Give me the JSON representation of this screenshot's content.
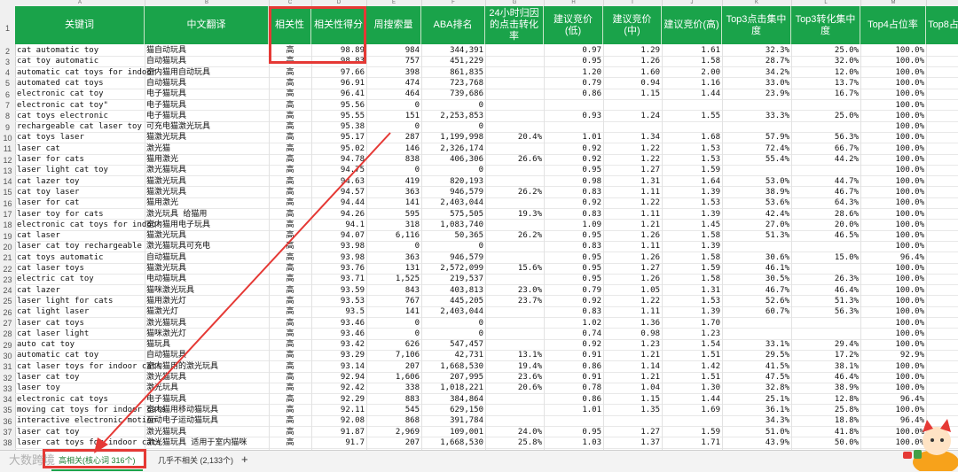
{
  "columns": [
    "A",
    "B",
    "C",
    "D",
    "E",
    "F",
    "G",
    "H",
    "I",
    "J",
    "K",
    "L",
    "M"
  ],
  "headers": [
    "关键词",
    "中文翻译",
    "相关性",
    "相关性得分",
    "周搜索量",
    "ABA排名",
    "24小时归因的点击转化率",
    "建议竞价(低)",
    "建议竞价(中)",
    "建议竞价(高)",
    "Top3点击集中度",
    "Top3转化集中度",
    "Top4占位率",
    "Top8占"
  ],
  "rows": [
    [
      "cat automatic toy",
      "猫自动玩具",
      "高",
      "98.89",
      "984",
      "344,391",
      "",
      "0.97",
      "1.29",
      "1.61",
      "32.3%",
      "25.0%",
      "100.0%"
    ],
    [
      "cat toy automatic",
      "自动猫玩具",
      "高",
      "98.83",
      "757",
      "451,229",
      "",
      "0.95",
      "1.26",
      "1.58",
      "28.7%",
      "32.0%",
      "100.0%"
    ],
    [
      "automatic cat toys for indoor",
      "室内猫用自动玩具",
      "高",
      "97.66",
      "398",
      "861,835",
      "",
      "1.20",
      "1.60",
      "2.00",
      "34.2%",
      "12.0%",
      "100.0%"
    ],
    [
      "automated cat toys",
      "自动猫玩具",
      "高",
      "96.91",
      "474",
      "723,768",
      "",
      "0.79",
      "0.94",
      "1.16",
      "33.0%",
      "13.7%",
      "100.0%"
    ],
    [
      "electronic cat toy",
      "电子猫玩具",
      "高",
      "96.41",
      "464",
      "739,686",
      "",
      "0.86",
      "1.15",
      "1.44",
      "23.9%",
      "16.7%",
      "100.0%"
    ],
    [
      "electronic cat toy\"",
      "电子猫玩具",
      "高",
      "95.56",
      "0",
      "0",
      "",
      "",
      "",
      "",
      "",
      "",
      "100.0%"
    ],
    [
      "cat toys electronic",
      "电子猫玩具",
      "高",
      "95.55",
      "151",
      "2,253,853",
      "",
      "0.93",
      "1.24",
      "1.55",
      "33.3%",
      "25.0%",
      "100.0%"
    ],
    [
      "rechargeable cat laser toy",
      "可充电猫激光玩具",
      "高",
      "95.38",
      "0",
      "0",
      "",
      "",
      "",
      "",
      "",
      "",
      "100.0%"
    ],
    [
      "cat toys laser",
      "猫激光玩具",
      "高",
      "95.17",
      "287",
      "1,199,998",
      "20.4%",
      "1.01",
      "1.34",
      "1.68",
      "57.9%",
      "56.3%",
      "100.0%"
    ],
    [
      "laser cat",
      "激光猫",
      "高",
      "95.02",
      "146",
      "2,326,174",
      "",
      "0.92",
      "1.22",
      "1.53",
      "72.4%",
      "66.7%",
      "100.0%"
    ],
    [
      "laser for cats",
      "猫用激光",
      "高",
      "94.78",
      "838",
      "406,306",
      "26.6%",
      "0.92",
      "1.22",
      "1.53",
      "55.4%",
      "44.2%",
      "100.0%"
    ],
    [
      "laser light cat toy",
      "激光猫玩具",
      "高",
      "94.75",
      "0",
      "0",
      "",
      "0.95",
      "1.27",
      "1.59",
      "",
      "",
      "100.0%"
    ],
    [
      "cat lazer toy",
      "猫激光玩具",
      "高",
      "94.63",
      "419",
      "820,193",
      "",
      "0.98",
      "1.31",
      "1.64",
      "53.0%",
      "44.7%",
      "100.0%"
    ],
    [
      "cat toy laser",
      "猫激光玩具",
      "高",
      "94.57",
      "363",
      "946,579",
      "26.2%",
      "0.83",
      "1.11",
      "1.39",
      "38.9%",
      "46.7%",
      "100.0%"
    ],
    [
      "laser for cat",
      "猫用激光",
      "高",
      "94.44",
      "141",
      "2,403,044",
      "",
      "0.92",
      "1.22",
      "1.53",
      "53.6%",
      "64.3%",
      "100.0%"
    ],
    [
      "laser toy for cats",
      "激光玩具 给猫用",
      "高",
      "94.26",
      "595",
      "575,505",
      "19.3%",
      "0.83",
      "1.11",
      "1.39",
      "42.4%",
      "28.6%",
      "100.0%"
    ],
    [
      "electronic cat toys for indoor",
      "室内猫用电子玩具",
      "高",
      "94.1",
      "318",
      "1,083,740",
      "",
      "1.09",
      "1.21",
      "1.45",
      "27.0%",
      "20.0%",
      "100.0%"
    ],
    [
      "cat laser",
      "猫激光玩具",
      "高",
      "94.07",
      "6,116",
      "50,365",
      "26.2%",
      "0.95",
      "1.26",
      "1.58",
      "51.3%",
      "46.5%",
      "100.0%"
    ],
    [
      "laser cat toy rechargeable",
      "激光猫玩具可充电",
      "高",
      "93.98",
      "0",
      "0",
      "",
      "0.83",
      "1.11",
      "1.39",
      "",
      "",
      "100.0%"
    ],
    [
      "cat toys automatic",
      "自动猫玩具",
      "高",
      "93.98",
      "363",
      "946,579",
      "",
      "0.95",
      "1.26",
      "1.58",
      "30.6%",
      "15.0%",
      "96.4%"
    ],
    [
      "cat laser toys",
      "猫激光玩具",
      "高",
      "93.76",
      "131",
      "2,572,099",
      "15.6%",
      "0.95",
      "1.27",
      "1.59",
      "46.1%",
      "",
      "100.0%"
    ],
    [
      "electric cat toy",
      "电动猫玩具",
      "高",
      "93.71",
      "1,525",
      "219,537",
      "",
      "0.95",
      "1.26",
      "1.58",
      "30.5%",
      "26.3%",
      "100.0%"
    ],
    [
      "cat lazer",
      "猫咪激光玩具",
      "高",
      "93.59",
      "843",
      "403,813",
      "23.0%",
      "0.79",
      "1.05",
      "1.31",
      "46.7%",
      "46.4%",
      "100.0%"
    ],
    [
      "laser light for cats",
      "猫用激光灯",
      "高",
      "93.53",
      "767",
      "445,205",
      "23.7%",
      "0.92",
      "1.22",
      "1.53",
      "52.6%",
      "51.3%",
      "100.0%"
    ],
    [
      "cat light laser",
      "猫激光灯",
      "高",
      "93.5",
      "141",
      "2,403,044",
      "",
      "0.83",
      "1.11",
      "1.39",
      "60.7%",
      "56.3%",
      "100.0%"
    ],
    [
      "laser cat toys",
      "激光猫玩具",
      "高",
      "93.46",
      "0",
      "0",
      "",
      "1.02",
      "1.36",
      "1.70",
      "",
      "",
      "100.0%"
    ],
    [
      "cat laser light",
      "猫咪激光灯",
      "高",
      "93.46",
      "0",
      "0",
      "",
      "0.74",
      "0.98",
      "1.23",
      "",
      "",
      "100.0%"
    ],
    [
      "auto cat toy",
      "猫玩具",
      "高",
      "93.42",
      "626",
      "547,457",
      "",
      "0.92",
      "1.23",
      "1.54",
      "33.1%",
      "29.4%",
      "100.0%"
    ],
    [
      "automatic cat toy",
      "自动猫玩具",
      "高",
      "93.29",
      "7,106",
      "42,731",
      "13.1%",
      "0.91",
      "1.21",
      "1.51",
      "29.5%",
      "17.2%",
      "92.9%"
    ],
    [
      "cat laser toys for indoor cats",
      "室内猫用的激光玩具",
      "高",
      "93.14",
      "207",
      "1,668,530",
      "19.4%",
      "0.86",
      "1.14",
      "1.42",
      "41.5%",
      "38.1%",
      "100.0%"
    ],
    [
      "laser cat toy",
      "激光猫玩具",
      "高",
      "92.94",
      "1,606",
      "207,995",
      "23.6%",
      "0.91",
      "1.21",
      "1.51",
      "47.5%",
      "46.4%",
      "100.0%"
    ],
    [
      "laser toy",
      "激光玩具",
      "高",
      "92.42",
      "338",
      "1,018,221",
      "20.6%",
      "0.78",
      "1.04",
      "1.30",
      "32.8%",
      "38.9%",
      "100.0%"
    ],
    [
      "electronic cat toys",
      "电子猫玩具",
      "高",
      "92.29",
      "883",
      "384,864",
      "",
      "0.86",
      "1.15",
      "1.44",
      "25.1%",
      "12.8%",
      "96.4%"
    ],
    [
      "moving cat toys for indoor cats",
      "室内猫用移动猫玩具",
      "高",
      "92.11",
      "545",
      "629,150",
      "",
      "1.01",
      "1.35",
      "1.69",
      "36.1%",
      "25.8%",
      "100.0%"
    ],
    [
      "interactive electronic motion",
      "互动电子运动猫玩具",
      "高",
      "92.08",
      "868",
      "391,784",
      "",
      "",
      "",
      "",
      "34.3%",
      "18.8%",
      "96.4%"
    ],
    [
      "laser cat toy",
      "激光猫玩具",
      "高",
      "91.87",
      "2,969",
      "109,001",
      "24.0%",
      "0.95",
      "1.27",
      "1.59",
      "51.0%",
      "41.8%",
      "100.0%"
    ],
    [
      "laser cat toys for indoor cats",
      "激光猫玩具 适用于室内猫咪",
      "高",
      "91.7",
      "207",
      "1,668,530",
      "25.8%",
      "1.03",
      "1.37",
      "1.71",
      "43.9%",
      "50.0%",
      "100.0%"
    ]
  ],
  "tabs": [
    {
      "label": "高相关(核心词 316个)"
    },
    {
      "label": "几乎不相关 (2,133个)"
    }
  ],
  "add_tab": "+",
  "watermark": "大数跨境"
}
